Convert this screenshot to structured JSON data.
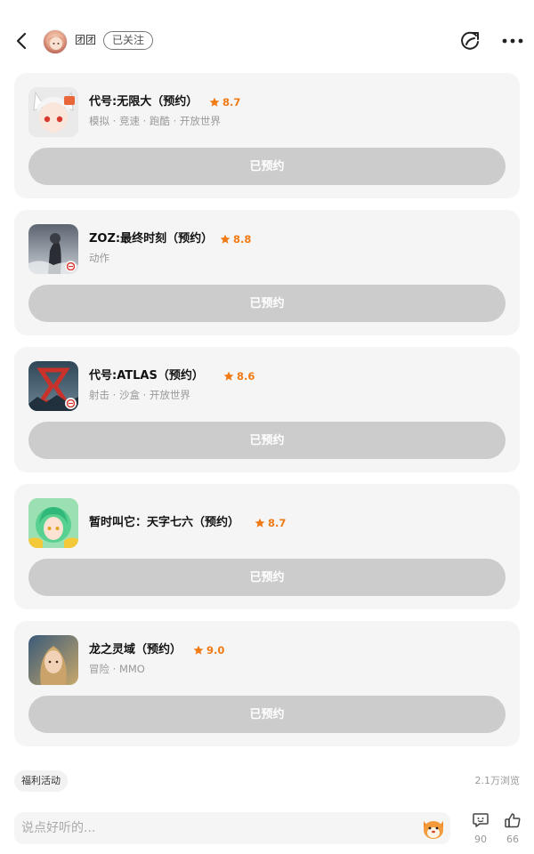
{
  "header": {
    "user_name": "团团",
    "follow_label": "已关注"
  },
  "games": [
    {
      "name": "代号:无限大（预约）",
      "rating": "8.7",
      "tags": "模拟 · 竞速 · 跑酷 · 开放世界",
      "button_label": "已预约"
    },
    {
      "name": "ZOZ:最终时刻（预约）",
      "rating": "8.8",
      "tags": "动作",
      "button_label": "已预约"
    },
    {
      "name": "代号:ATLAS（预约）",
      "rating": "8.6",
      "tags": "射击 · 沙盒 · 开放世界",
      "button_label": "已预约"
    },
    {
      "name": "暂时叫它：天字七六（预约）",
      "rating": "8.7",
      "tags": "",
      "button_label": "已预约"
    },
    {
      "name": "龙之灵域（预约）",
      "rating": "9.0",
      "tags": "冒险 · MMO",
      "button_label": "已预约"
    }
  ],
  "footer": {
    "tag": "福利活动",
    "views": "2.1万浏览",
    "comment_placeholder": "说点好听的...",
    "comment_count": "90",
    "like_count": "66"
  },
  "colors": {
    "accent": "#f07a14",
    "button_disabled": "#cccccc",
    "card_bg": "#f5f5f5"
  }
}
